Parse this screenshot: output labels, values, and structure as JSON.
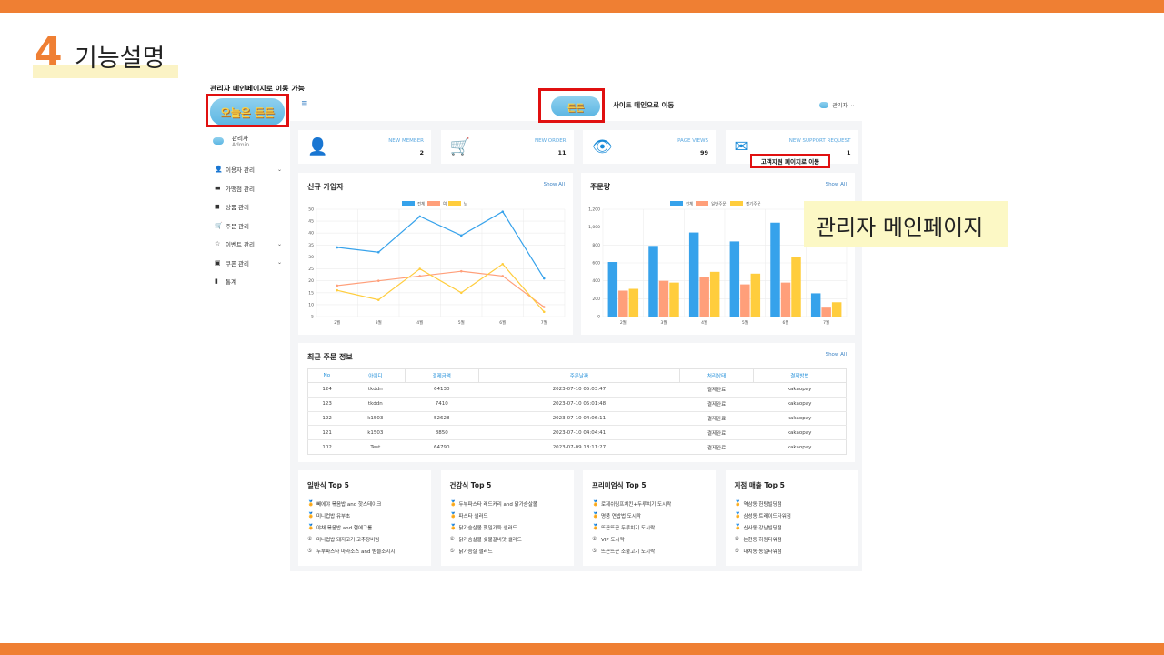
{
  "slide": {
    "number": "4",
    "title": "기능설명",
    "caption_admin_link": "관리자 메인페이지로 이동 가능",
    "callout": "관리자 메인페이지",
    "support_tip": "고객지원 페이지로 이동",
    "accent_color": "#ef7f33"
  },
  "logo": {
    "text": "오늘은 든든",
    "top_text": "든든"
  },
  "sidebar": {
    "profile_name": "관리자",
    "profile_role": "Admin",
    "items": [
      {
        "icon": "user-icon",
        "glyph": "👤",
        "label": "이용자 관리",
        "has_submenu": true
      },
      {
        "icon": "store-icon",
        "glyph": "▬",
        "label": "가맹점 관리",
        "has_submenu": false
      },
      {
        "icon": "bag-icon",
        "glyph": "◼",
        "label": "상품 관리",
        "has_submenu": false
      },
      {
        "icon": "cart-icon",
        "glyph": "🛒",
        "label": "주문 관리",
        "has_submenu": false
      },
      {
        "icon": "star-icon",
        "glyph": "☆",
        "label": "이벤트 관리",
        "has_submenu": true
      },
      {
        "icon": "gift-icon",
        "glyph": "▣",
        "label": "쿠폰 관리",
        "has_submenu": true
      },
      {
        "icon": "chart-bar-icon",
        "glyph": "▮",
        "label": "통계",
        "has_submenu": false
      }
    ],
    "chevron": "⌄"
  },
  "topbar": {
    "menu_glyph": "≡",
    "site_link": "사이트 메인으로 이동",
    "user_label": "관리자",
    "user_chevron": "⌄"
  },
  "stats": [
    {
      "icon": "add-user-icon",
      "glyph": "👤",
      "label": "NEW MEMBER",
      "value": "2"
    },
    {
      "icon": "cart-icon",
      "glyph": "🛒",
      "label": "NEW ORDER",
      "value": "11"
    },
    {
      "icon": "eye-icon",
      "glyph": "👁",
      "label": "PAGE VIEWS",
      "value": "99"
    },
    {
      "icon": "mail-icon",
      "glyph": "✉",
      "label": "NEW SUPPORT REQUEST",
      "value": "1"
    }
  ],
  "signup_panel": {
    "title": "신규 가입자",
    "show_all": "Show All"
  },
  "order_panel": {
    "title": "주문량",
    "show_all": "Show All"
  },
  "chart_data": [
    {
      "type": "line",
      "title": "",
      "categories": [
        "2월",
        "3월",
        "4월",
        "5월",
        "6월",
        "7월"
      ],
      "series": [
        {
          "name": "전체",
          "color": "#36a2eb",
          "values": [
            34,
            32,
            47,
            39,
            49,
            21
          ]
        },
        {
          "name": "여",
          "color": "#ff9f7a",
          "values": [
            18,
            20,
            22,
            24,
            22,
            9
          ]
        },
        {
          "name": "남",
          "color": "#ffcd3d",
          "values": [
            16,
            12,
            25,
            15,
            27,
            7
          ]
        }
      ],
      "ylim": [
        5,
        50
      ],
      "yticks": [
        5,
        10,
        15,
        20,
        25,
        30,
        35,
        40,
        45,
        50
      ],
      "legend": "top",
      "grid": true
    },
    {
      "type": "bar",
      "title": "",
      "categories": [
        "2월",
        "3월",
        "4월",
        "5월",
        "6월",
        "7월"
      ],
      "series": [
        {
          "name": "전체",
          "color": "#36a2eb",
          "values": [
            610,
            790,
            940,
            840,
            1050,
            260
          ]
        },
        {
          "name": "일반주문",
          "color": "#ff9f7a",
          "values": [
            290,
            400,
            440,
            360,
            380,
            100
          ]
        },
        {
          "name": "정기주문",
          "color": "#ffcd3d",
          "values": [
            310,
            380,
            500,
            480,
            670,
            160
          ]
        }
      ],
      "ylim": [
        0,
        1200
      ],
      "yticks": [
        0,
        200,
        400,
        600,
        800,
        1000,
        1200
      ],
      "ytick_labels": [
        "0",
        "200",
        "400",
        "600",
        "800",
        "1,000",
        "1,200"
      ],
      "legend": "top",
      "grid": true
    }
  ],
  "orders": {
    "title": "최근 주문 정보",
    "show_all": "Show All",
    "columns": [
      "No",
      "아이디",
      "결제금액",
      "주문날짜",
      "처리상태",
      "결제방법"
    ],
    "rows": [
      [
        "124",
        "tkddn",
        "64130",
        "2023-07-10 05:03:47",
        "결제완료",
        "kakaopay"
      ],
      [
        "123",
        "tkddn",
        "7410",
        "2023-07-10 05:01:48",
        "결제완료",
        "kakaopay"
      ],
      [
        "122",
        "k1503",
        "52628",
        "2023-07-10 04:06:11",
        "결제완료",
        "kakaopay"
      ],
      [
        "121",
        "k1503",
        "8850",
        "2023-07-10 04:04:41",
        "결제완료",
        "kakaopay"
      ],
      [
        "102",
        "Test",
        "64790",
        "2023-07-09 18:11:27",
        "결제완료",
        "kakaopay"
      ]
    ]
  },
  "top5": [
    {
      "title": "일반식 Top 5",
      "items": [
        "빼에야 볶음밥 and 핫스테이크",
        "미니컵밥 유부초",
        "야채 볶음밥 and 햄에그롤",
        "미니컵밥 돼지고기 고추장비빔",
        "두부파스타 마라소스 and 받을소시지"
      ]
    },
    {
      "title": "건강식 Top 5",
      "items": [
        "두부파스타 레드커리 and 닭가슴살볼",
        "파스타 샐러드",
        "닭가슴살볼 햇밀가득 샐러드",
        "닭가슴살볼 숯불갈비맛 샐러드",
        "닭가슴살 샐러드"
      ]
    },
    {
      "title": "프리미엄식 Top 5",
      "items": [
        "로제쉬림프치킨+두루치기 도시락",
        "명품 연밥법 도시락",
        "뜨끈뜨끈 두루치기 도시락",
        "VIP 도시락",
        "뜨끈뜨끈 소불고기 도시락"
      ]
    },
    {
      "title": "지점 매출 Top 5",
      "items": [
        "역삼동 헌팅빌딩점",
        "삼성동 트레이드타워점",
        "신사동 강남빌딩점",
        "논현동 하림타워점",
        "대치동 동일타워점"
      ]
    }
  ],
  "medals": [
    "🏅",
    "🏅",
    "🏅",
    "⑤",
    "⑤"
  ]
}
